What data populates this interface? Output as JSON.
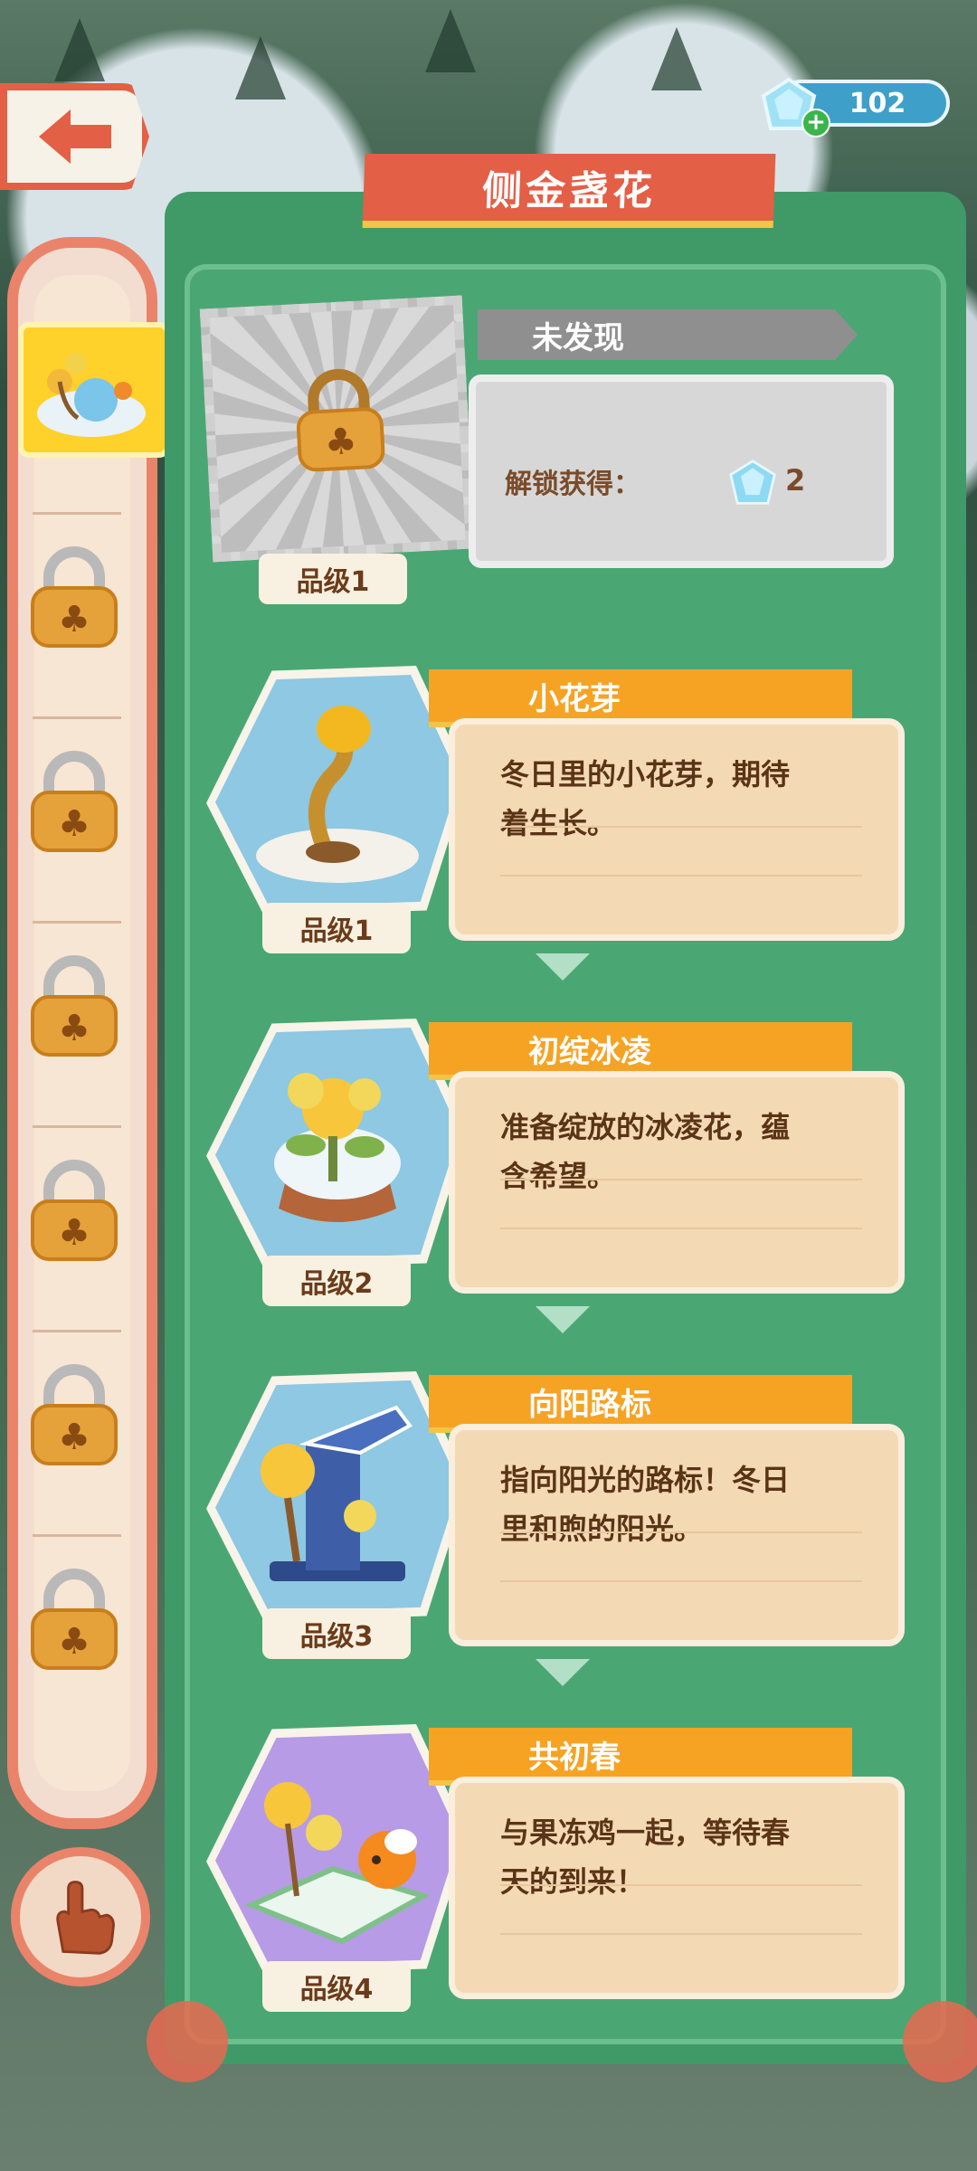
{
  "topbar": {
    "gem_count": "102",
    "icons": {
      "back": "back-arrow-icon",
      "gem": "gem-icon",
      "plus": "plus-icon"
    }
  },
  "panel": {
    "title": "侧金盏花"
  },
  "locked_card": {
    "status": "未发现",
    "unlock_label": "解锁获得：",
    "reward_value": "2",
    "grade": "品级1"
  },
  "stages": [
    {
      "name": "小花芽",
      "desc_line1": "冬日里的小花芽，期待",
      "desc_line2": "着生长。",
      "grade": "品级1"
    },
    {
      "name": "初绽冰凌",
      "desc_line1": "准备绽放的冰凌花，蕴",
      "desc_line2": "含希望。",
      "grade": "品级2"
    },
    {
      "name": "向阳路标",
      "desc_line1": "指向阳光的路标！冬日",
      "desc_line2": "里和煦的阳光。",
      "grade": "品级3"
    },
    {
      "name": "共初春",
      "desc_line1": "与果冻鸡一起，等待春",
      "desc_line2": "天的到来！",
      "grade": "品级4"
    }
  ],
  "colors": {
    "accent_red": "#e35f46",
    "panel_green": "#3f9a68",
    "ribbon_orange": "#f6a324",
    "card_peach": "#f4d9b5"
  }
}
